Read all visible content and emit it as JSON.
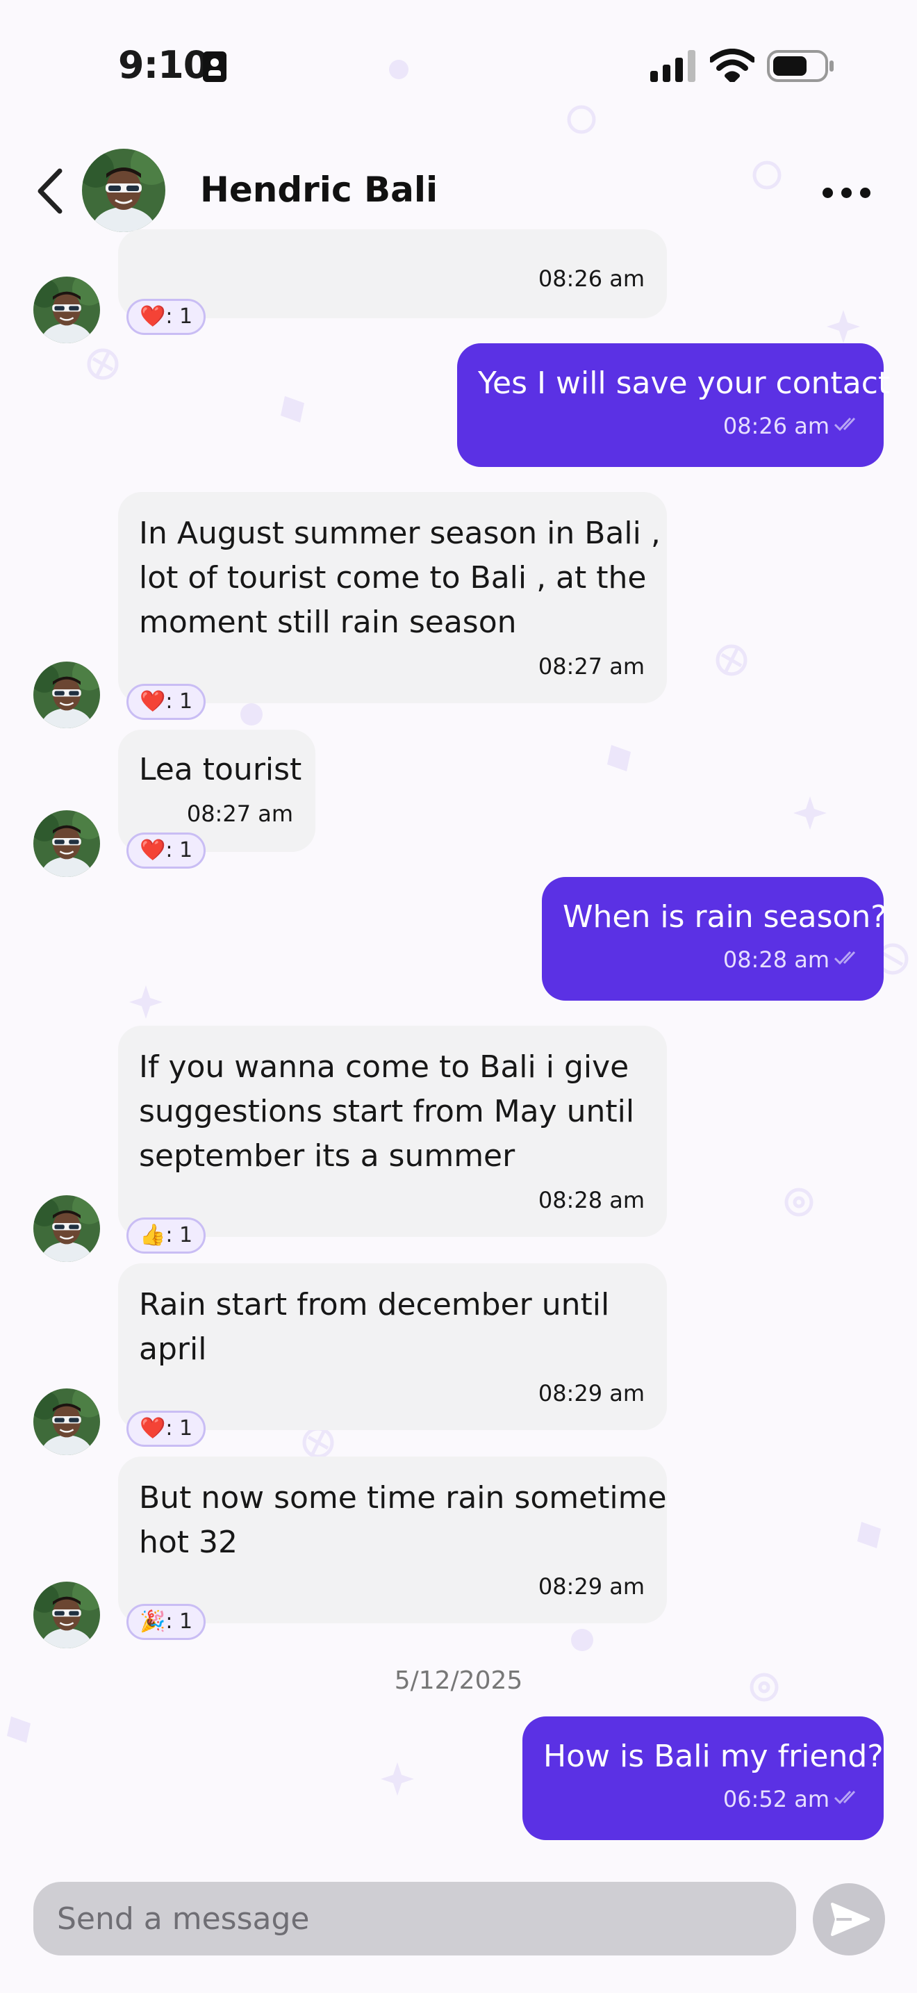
{
  "status_bar": {
    "time": "9:10"
  },
  "header": {
    "contact_name": "Hendric Bali"
  },
  "messages": [
    {
      "id": "m0",
      "direction": "incoming",
      "time": "08:26 am",
      "reaction": {
        "emoji": "❤️",
        "count": ": 1"
      }
    },
    {
      "id": "m1",
      "direction": "outgoing",
      "text": [
        "Yes I will save your contact"
      ],
      "time": "08:26 am",
      "status_icon": "double-check-icon"
    },
    {
      "id": "m2",
      "direction": "incoming",
      "text": [
        "In August summer season in Bali ,",
        "lot of tourist come to Bali , at the",
        "moment still rain season"
      ],
      "time": "08:27 am",
      "reaction": {
        "emoji": "❤️",
        "count": ": 1"
      }
    },
    {
      "id": "m3",
      "direction": "incoming",
      "text": [
        "Lea tourist"
      ],
      "time": "08:27 am",
      "reaction": {
        "emoji": "❤️",
        "count": ": 1"
      }
    },
    {
      "id": "m4",
      "direction": "outgoing",
      "text": [
        "When is rain season?"
      ],
      "time": "08:28 am",
      "status_icon": "double-check-icon"
    },
    {
      "id": "m5",
      "direction": "incoming",
      "text": [
        "If you wanna come to Bali i give",
        "suggestions start from May until",
        "september its a summer"
      ],
      "time": "08:28 am",
      "reaction": {
        "emoji": "👍",
        "count": ": 1"
      }
    },
    {
      "id": "m6",
      "direction": "incoming",
      "text": [
        "Rain start from december until",
        "april"
      ],
      "time": "08:29 am",
      "reaction": {
        "emoji": "❤️",
        "count": ": 1"
      }
    },
    {
      "id": "m7",
      "direction": "incoming",
      "text": [
        "But now some time rain sometime",
        "hot 32"
      ],
      "time": "08:29 am",
      "reaction": {
        "emoji": "🎉",
        "count": ": 1"
      }
    },
    {
      "id": "m8",
      "direction": "outgoing",
      "text": [
        "How is Bali my friend?"
      ],
      "time": "06:52 am",
      "status_icon": "double-check-icon"
    }
  ],
  "date_separator": "5/12/2025",
  "composer": {
    "placeholder": "Send a message"
  },
  "colors": {
    "accent": "#5b31e4",
    "incoming_bubble": "#f2f2f3",
    "reaction_border": "#c9bdf4",
    "background": "#fbf9fd"
  }
}
